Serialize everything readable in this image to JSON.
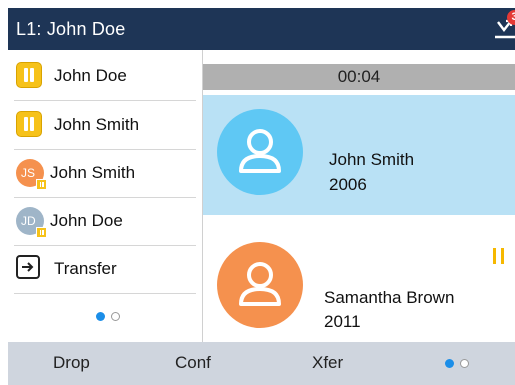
{
  "header": {
    "title": "L1: John Doe",
    "notification_count": "3",
    "notification_icon": "missed-call-icon"
  },
  "left_list": {
    "items": [
      {
        "label": "John Doe",
        "icon": "pause-icon"
      },
      {
        "label": "John Smith",
        "icon": "pause-icon"
      },
      {
        "label": "John Smith",
        "initials": "JS",
        "avatar_color": "#f5914e"
      },
      {
        "label": "John Doe",
        "initials": "JD",
        "avatar_color": "#9fb5c8"
      },
      {
        "label": "Transfer",
        "icon": "transfer-icon"
      }
    ],
    "pager": {
      "page": 1,
      "pages": 2
    }
  },
  "active_call": {
    "timer": "00:04"
  },
  "calls": [
    {
      "name": "John Smith",
      "number": "2006",
      "avatar_color": "#5fc8f4",
      "highlighted": true
    },
    {
      "name": "Samantha Brown",
      "number": "2011",
      "avatar_color": "#f5914e",
      "on_hold": true
    }
  ],
  "softkeys": {
    "drop": "Drop",
    "conf": "Conf",
    "xfer": "Xfer",
    "pager": {
      "page": 1,
      "pages": 2
    }
  },
  "colors": {
    "header_bg": "#1e3556",
    "highlight": "#b9e1f5",
    "hold_yellow": "#f6c21a",
    "pager_active": "#1b8ee8"
  }
}
